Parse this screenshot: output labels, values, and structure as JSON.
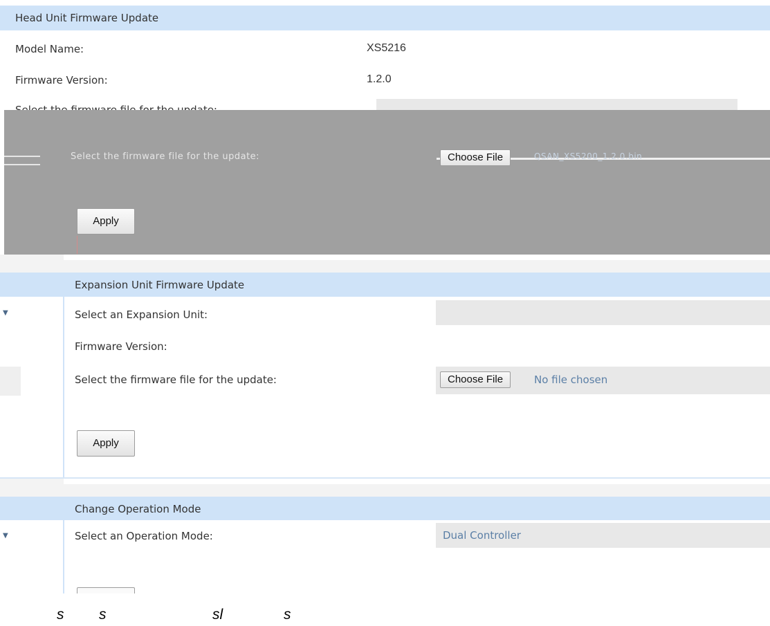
{
  "head_unit": {
    "title": "Head Unit Firmware Update",
    "model_label": "Model Name:",
    "model_value": "XS5216",
    "fw_label": "Firmware Version:",
    "fw_value": "1.2.0",
    "select_label": "Select the firmware file for the update:",
    "choose_label": "Choose File",
    "file_name": "QSAN_XS5200_1.2.0.bin",
    "apply_label": "Apply"
  },
  "expansion_unit": {
    "title": "Expansion Unit Firmware Update",
    "select_unit_label": "Select an Expansion Unit:",
    "fw_label": "Firmware Version:",
    "select_label": "Select the firmware file for the update:",
    "choose_label": "Choose File",
    "file_status": "No file chosen",
    "apply_label": "Apply"
  },
  "operation_mode": {
    "title": "Change Operation Mode",
    "select_label": "Select an Operation Mode:",
    "selected_value": "Dual Controller"
  },
  "stray_glyphs": [
    "s",
    "s",
    "sl",
    "s"
  ]
}
